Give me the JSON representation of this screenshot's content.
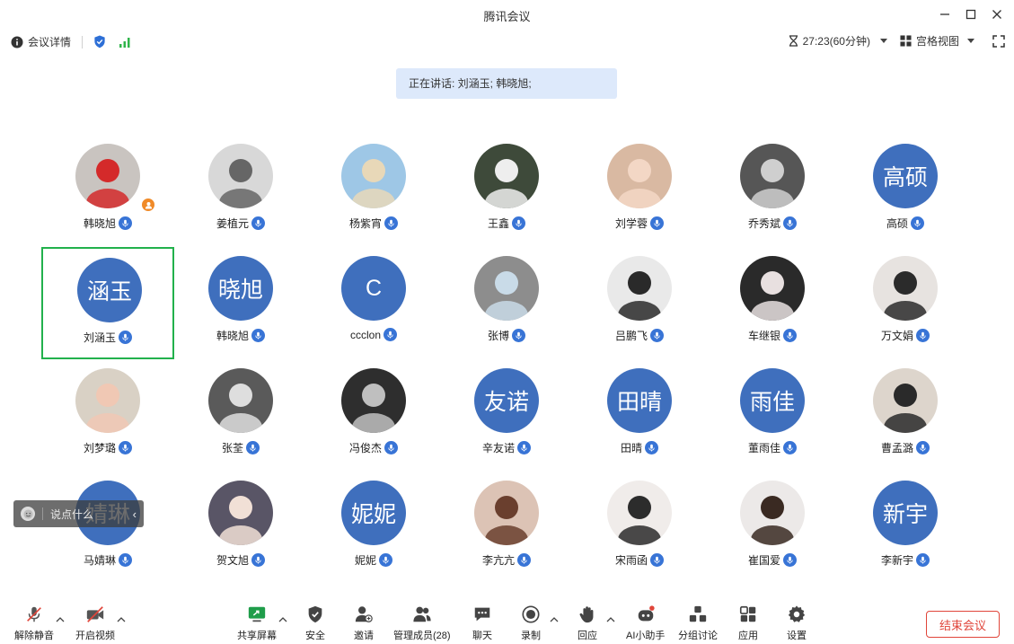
{
  "window": {
    "title": "腾讯会议"
  },
  "infobar": {
    "meeting_details": "会议详情",
    "timer": "27:23(60分钟)",
    "view_mode": "宫格视图"
  },
  "speaking": {
    "text": "正在讲话: 刘涵玉; 韩晓旭;"
  },
  "participants": [
    {
      "name": "韩晓旭",
      "avatar_text": "",
      "host": true
    },
    {
      "name": "姜植元",
      "avatar_text": ""
    },
    {
      "name": "杨紫宵",
      "avatar_text": ""
    },
    {
      "name": "王鑫",
      "avatar_text": ""
    },
    {
      "name": "刘学蓉",
      "avatar_text": ""
    },
    {
      "name": "乔秀斌",
      "avatar_text": ""
    },
    {
      "name": "高硕",
      "avatar_text": "高硕"
    },
    {
      "name": "刘涵玉",
      "avatar_text": "涵玉",
      "active": true
    },
    {
      "name": "韩晓旭",
      "avatar_text": "晓旭"
    },
    {
      "name": "ccclon",
      "avatar_text": "C"
    },
    {
      "name": "张博",
      "avatar_text": ""
    },
    {
      "name": "吕鹏飞",
      "avatar_text": ""
    },
    {
      "name": "车继银",
      "avatar_text": ""
    },
    {
      "name": "万文娟",
      "avatar_text": ""
    },
    {
      "name": "刘梦璐",
      "avatar_text": ""
    },
    {
      "name": "张荃",
      "avatar_text": ""
    },
    {
      "name": "冯俊杰",
      "avatar_text": ""
    },
    {
      "name": "辛友诺",
      "avatar_text": "友诺"
    },
    {
      "name": "田晴",
      "avatar_text": "田晴"
    },
    {
      "name": "董雨佳",
      "avatar_text": "雨佳"
    },
    {
      "name": "曹孟潞",
      "avatar_text": ""
    },
    {
      "name": "马婧琳",
      "avatar_text": "婧琳"
    },
    {
      "name": "贺文旭",
      "avatar_text": ""
    },
    {
      "name": "妮妮",
      "avatar_text": "妮妮"
    },
    {
      "name": "李亢亢",
      "avatar_text": ""
    },
    {
      "name": "宋雨函",
      "avatar_text": ""
    },
    {
      "name": "崔国爱",
      "avatar_text": ""
    },
    {
      "name": "李新宇",
      "avatar_text": "新宇"
    }
  ],
  "chat": {
    "placeholder": "说点什么"
  },
  "toolbar": {
    "unmute": "解除静音",
    "start_video": "开启视频",
    "share_screen": "共享屏幕",
    "security": "安全",
    "invite": "邀请",
    "manage_members": "管理成员(28)",
    "chat": "聊天",
    "record": "录制",
    "react": "回应",
    "ai_assistant": "AI小助手",
    "breakout": "分组讨论",
    "apps": "应用",
    "settings": "设置",
    "end_meeting": "结束会议"
  },
  "colors": {
    "avatar_blue": "#3f6fbd",
    "active_border": "#22b14c",
    "end_red": "#e0453a",
    "speaking_bg": "#dde9fb"
  }
}
